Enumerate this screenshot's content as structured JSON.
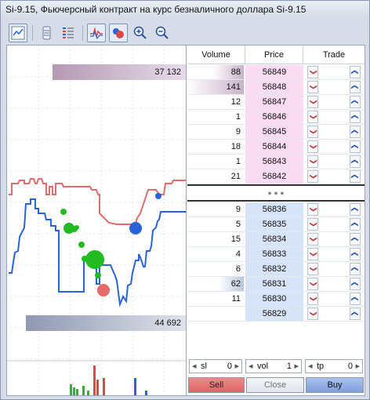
{
  "window": {
    "title": "Si-9.15, Фьючерсный контракт на курс безналичного доллара Si-9.15"
  },
  "toolbar": {
    "buttons": [
      "chart-icon",
      "depth-icon",
      "trades-icon",
      "ticks-icon",
      "bubbles-icon",
      "zoom-in-icon",
      "zoom-out-icon"
    ]
  },
  "chart": {
    "top_volume_label": "37 132",
    "bottom_volume_label": "44 692",
    "ask_line_color": "#e06c6c",
    "bid_line_color": "#2a63d8",
    "buy_bubble_color": "#22bb22",
    "sell_bubble_color": "#e66a6a",
    "bottom_volume_bars_colors": [
      "#22bb22",
      "#d94a4a",
      "#2a63d8"
    ]
  },
  "book": {
    "headers": {
      "volume": "Volume",
      "price": "Price",
      "trade": "Trade"
    },
    "asks": [
      {
        "volume": "88",
        "price": "56849",
        "depth": 0.55
      },
      {
        "volume": "141",
        "price": "56848",
        "depth": 1.0
      },
      {
        "volume": "12",
        "price": "56847",
        "depth": 0.0
      },
      {
        "volume": "1",
        "price": "56846",
        "depth": 0.0
      },
      {
        "volume": "9",
        "price": "56845",
        "depth": 0.0
      },
      {
        "volume": "18",
        "price": "56844",
        "depth": 0.0
      },
      {
        "volume": "1",
        "price": "56843",
        "depth": 0.0
      },
      {
        "volume": "21",
        "price": "56842",
        "depth": 0.0
      }
    ],
    "spread_dots": "● ● ●",
    "bids": [
      {
        "volume": "9",
        "price": "56836",
        "depth": 0.0
      },
      {
        "volume": "5",
        "price": "56835",
        "depth": 0.0
      },
      {
        "volume": "15",
        "price": "56834",
        "depth": 0.0
      },
      {
        "volume": "4",
        "price": "56833",
        "depth": 0.0
      },
      {
        "volume": "6",
        "price": "56832",
        "depth": 0.0
      },
      {
        "volume": "62",
        "price": "56831",
        "depth": 0.45
      },
      {
        "volume": "11",
        "price": "56830",
        "depth": 0.0
      },
      {
        "volume": "",
        "price": "56829",
        "depth": 0.0
      }
    ],
    "ask_price_bg": "#f9dbf2",
    "bid_price_bg": "#d7e3f6"
  },
  "controls": {
    "sl_label": "sl",
    "sl_value": "0",
    "vol_label": "vol",
    "vol_value": "1",
    "tp_label": "tp",
    "tp_value": "0"
  },
  "buttons": {
    "sell": "Sell",
    "close": "Close",
    "buy": "Buy"
  }
}
